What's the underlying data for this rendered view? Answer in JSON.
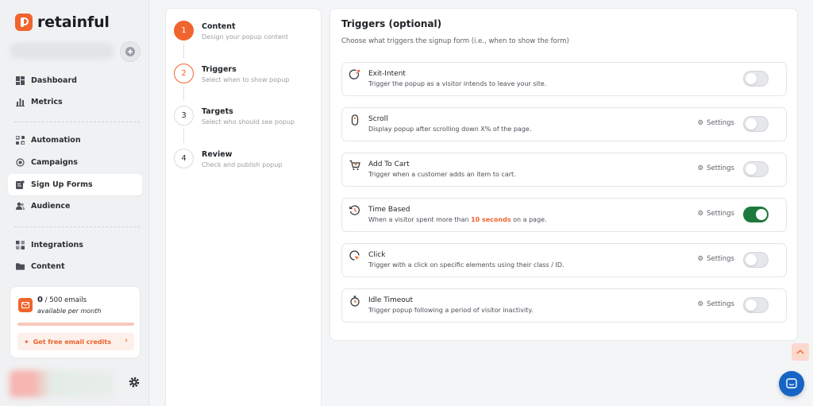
{
  "brand": {
    "name": "retainful",
    "accent": "#f0642d"
  },
  "sidebar": {
    "add_icon": "plus-icon",
    "items": [
      {
        "label": "Dashboard",
        "icon": "dashboard-icon",
        "active": false
      },
      {
        "label": "Metrics",
        "icon": "bar-chart-icon",
        "active": false
      },
      {
        "label": "Automation",
        "icon": "automation-icon",
        "active": false
      },
      {
        "label": "Campaigns",
        "icon": "campaign-icon",
        "active": false
      },
      {
        "label": "Sign Up Forms",
        "icon": "form-icon",
        "active": true
      },
      {
        "label": "Audience",
        "icon": "users-icon",
        "active": false
      },
      {
        "label": "Integrations",
        "icon": "grid-icon",
        "active": false
      },
      {
        "label": "Content",
        "icon": "folder-icon",
        "active": false
      }
    ],
    "credits": {
      "used": "0",
      "total": "/ 500 emails",
      "period": "available per month",
      "progress": 0,
      "cta": "Get free email credits"
    }
  },
  "steps": [
    {
      "number": "1",
      "title": "Content",
      "subtitle": "Design your popup content",
      "state": "done"
    },
    {
      "number": "2",
      "title": "Triggers",
      "subtitle": "Select when to show popup",
      "state": "current"
    },
    {
      "number": "3",
      "title": "Targets",
      "subtitle": "Select who should see popup",
      "state": "todo"
    },
    {
      "number": "4",
      "title": "Review",
      "subtitle": "Check and publish popup",
      "state": "todo"
    }
  ],
  "triggers": {
    "title": "Triggers (optional)",
    "subtitle": "Choose what triggers the signup form (i.e., when to show the form)",
    "settings_label": "Settings",
    "items": [
      {
        "name": "Exit-Intent",
        "desc": "Trigger the popup as a visitor intends to leave your site.",
        "icon": "exit-intent-icon",
        "has_settings": false,
        "enabled": false
      },
      {
        "name": "Scroll",
        "desc": "Display popup after scrolling down X% of the page.",
        "icon": "mouse-scroll-icon",
        "has_settings": true,
        "enabled": false
      },
      {
        "name": "Add To Cart",
        "desc": "Trigger when a customer adds an item to cart.",
        "icon": "cart-icon",
        "has_settings": true,
        "enabled": false
      },
      {
        "name": "Time Based",
        "desc_before": "When a visitor spent more than ",
        "desc_highlight": "10 seconds",
        "desc_after": " on a page.",
        "icon": "history-clock-icon",
        "has_settings": true,
        "enabled": true
      },
      {
        "name": "Click",
        "desc": "Trigger with a click on specific elements using their class / ID.",
        "icon": "click-icon",
        "has_settings": true,
        "enabled": false
      },
      {
        "name": "Idle Timeout",
        "desc": "Trigger popup following a period of visitor inactivity.",
        "icon": "stopwatch-icon",
        "has_settings": true,
        "enabled": false
      }
    ]
  },
  "colors": {
    "toggle_on": "#1e7a3c",
    "chat": "#1764c4"
  }
}
